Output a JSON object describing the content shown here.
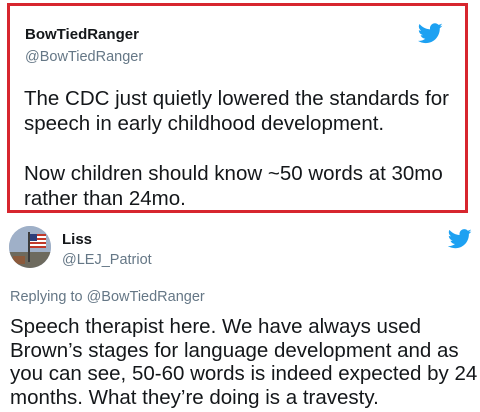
{
  "quoted_tweet": {
    "display_name": "BowTiedRanger",
    "handle": "@BowTiedRanger",
    "text_p1": "The CDC just quietly lowered the standards for speech in early childhood development.",
    "text_p2": "Now children should know ~50 words at 30mo rather than 24mo.",
    "highlight_color": "#d7262e"
  },
  "reply_tweet": {
    "display_name": "Liss",
    "handle": "@LEJ_Patriot",
    "replying_prefix": "Replying to",
    "replying_to": "@BowTiedRanger",
    "text": "Speech therapist here. We have always used Brown’s stages for language development and as you can see, 50-60 words is indeed expected by 24 months. What they’re doing is a travesty."
  },
  "icons": {
    "bird": "twitter-bird-icon",
    "avatar": "flag-avatar"
  },
  "colors": {
    "twitter_blue": "#1da1f2",
    "secondary_text": "#657786"
  }
}
